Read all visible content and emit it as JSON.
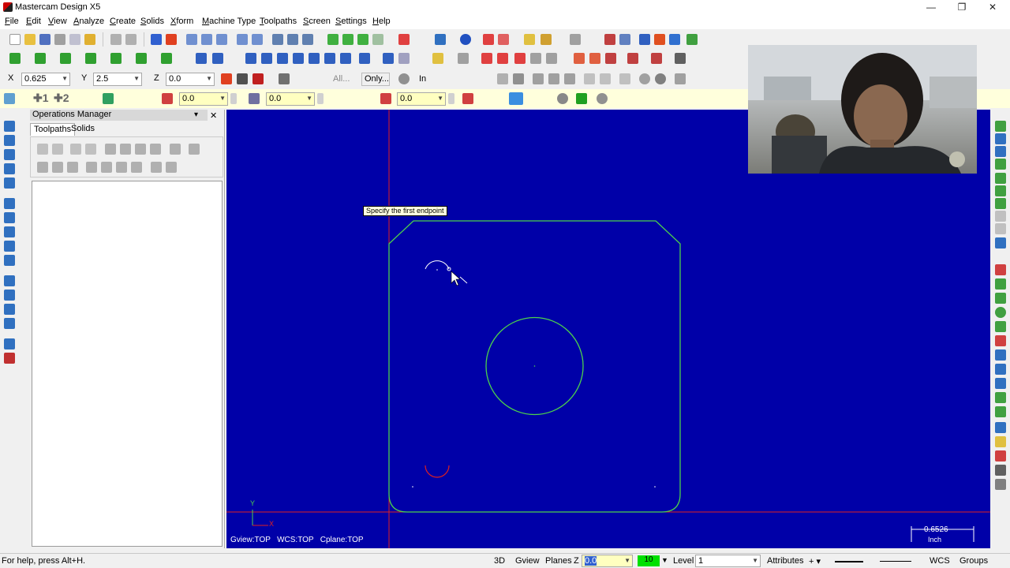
{
  "window": {
    "title": "Mastercam Design X5",
    "minimize_glyph": "—",
    "maximize_glyph": "❐",
    "close_glyph": "✕"
  },
  "menu": [
    "File",
    "Edit",
    "View",
    "Analyze",
    "Create",
    "Solids",
    "Xform",
    "Machine Type",
    "Toolpaths",
    "Screen",
    "Settings",
    "Help"
  ],
  "ribbon": {
    "x_label": "X",
    "x_value": "0.625",
    "y_label": "Y",
    "y_value": "2.5",
    "z_label": "Z",
    "z_value": "0.0",
    "all_button": "All...",
    "only_button": "Only...",
    "in_label": "In",
    "row4_value_1": "0.0",
    "row4_value_2": "0.0",
    "row4_value_3": "0.0"
  },
  "ops_manager": {
    "title": "Operations Manager",
    "tabs": [
      "Toolpaths",
      "Solids"
    ],
    "close_glyph": "✕",
    "pin_glyph": "▾"
  },
  "viewport": {
    "prompt": "Specify the first endpoint",
    "view_info": "Gview:TOP   WCS:TOP   Cplane:TOP",
    "axis_y": "Y",
    "axis_x": "X",
    "scale_value": "0.6526",
    "scale_unit": "Inch"
  },
  "statusbar": {
    "help": "For help, press Alt+H.",
    "btn_3d": "3D",
    "gview": "Gview",
    "planes": "Planes",
    "z_label": "Z",
    "z_value": "0.0",
    "color_value": "10",
    "level_label": "Level",
    "level_value": "1",
    "attributes": "Attributes",
    "wcs": "WCS",
    "groups": "Groups"
  },
  "colors": {
    "viewport_bg": "#0000a8",
    "geometry": "#4cd14c",
    "axis": "#e02020",
    "highlight_row": "#ffffdc"
  }
}
